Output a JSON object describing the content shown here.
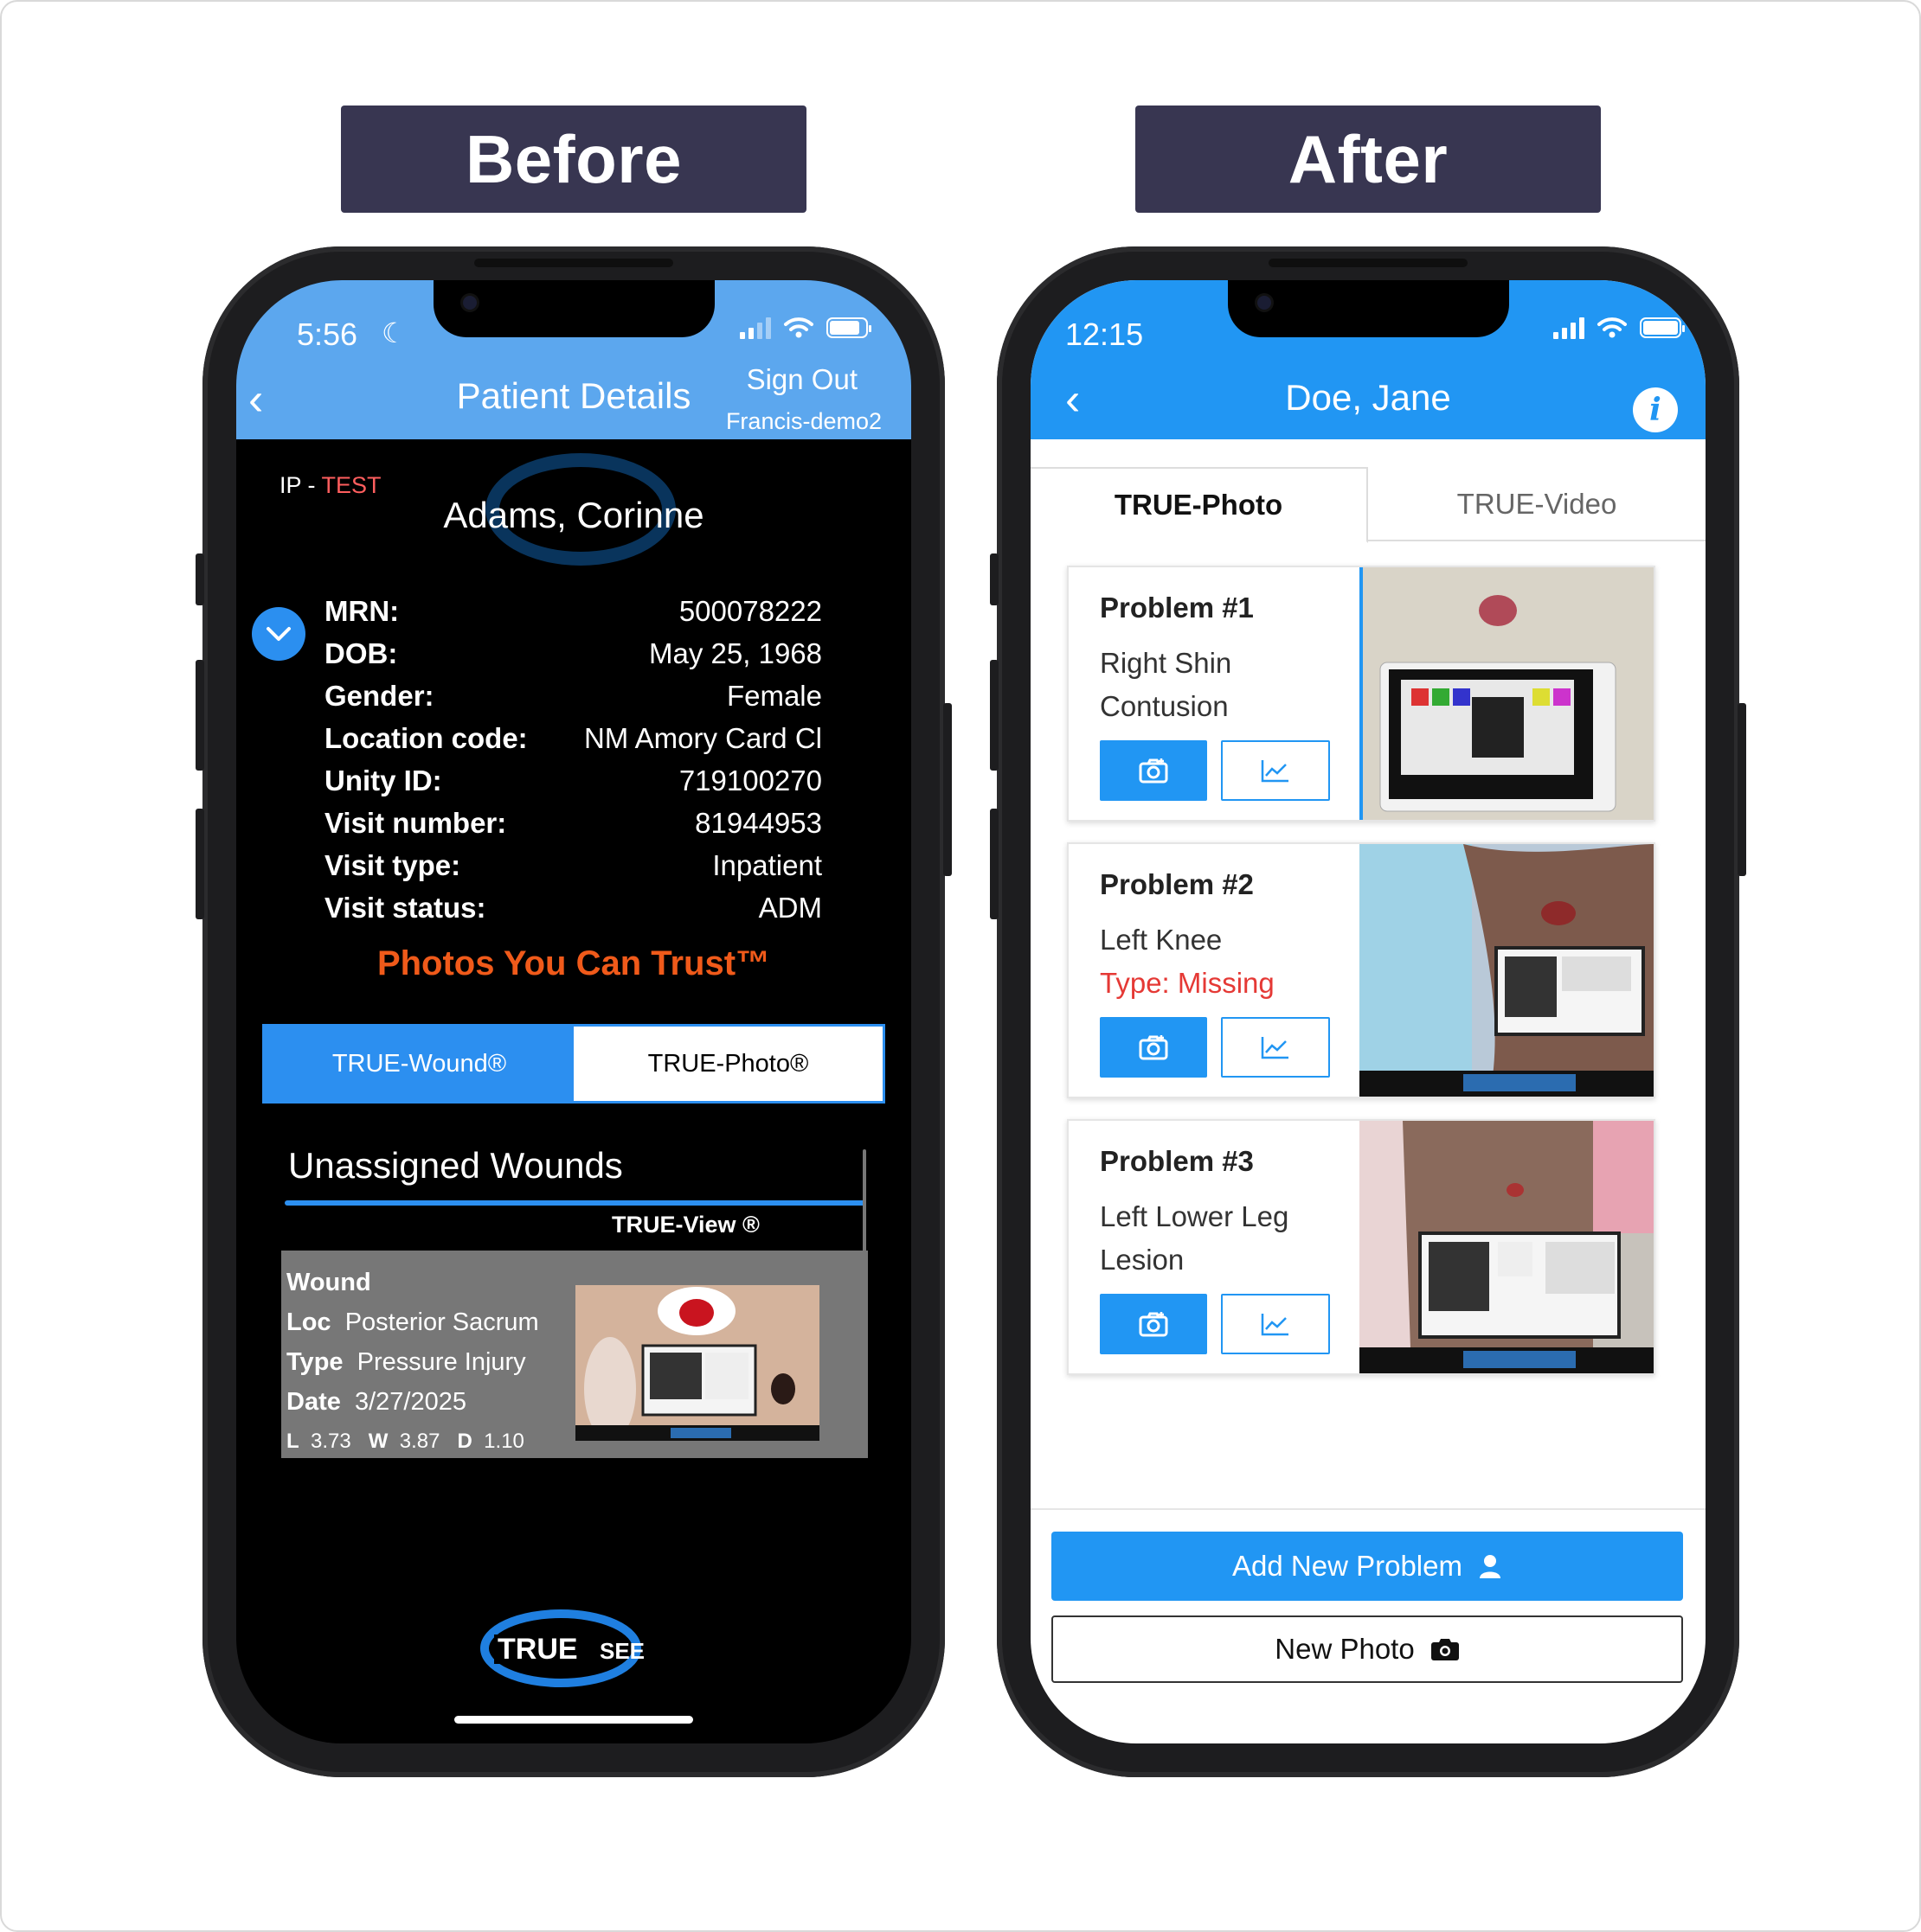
{
  "labels": {
    "before": "Before",
    "after": "After"
  },
  "before": {
    "status_time": "5:56",
    "header": {
      "title": "Patient Details",
      "sign_out": "Sign Out",
      "user": "Francis-demo2"
    },
    "ip_prefix": "IP - ",
    "ip_tag": "TEST",
    "patient_name": "Adams, Corinne",
    "details": [
      {
        "key": "MRN:",
        "value": "500078222"
      },
      {
        "key": "DOB:",
        "value": "May 25, 1968"
      },
      {
        "key": "Gender:",
        "value": "Female"
      },
      {
        "key": "Location code:",
        "value": "NM Amory Card Cl"
      },
      {
        "key": "Unity ID:",
        "value": "719100270"
      },
      {
        "key": "Visit number:",
        "value": "81944953"
      },
      {
        "key": "Visit type:",
        "value": "Inpatient"
      },
      {
        "key": "Visit status:",
        "value": "ADM"
      }
    ],
    "tagline": "Photos You Can Trust™",
    "tabs": [
      "TRUE-Wound®",
      "TRUE-Photo®"
    ],
    "section_title": "Unassigned Wounds",
    "trueview": "TRUE-View ®",
    "wound": {
      "heading": "Wound",
      "loc_label": "Loc",
      "loc": "Posterior Sacrum",
      "type_label": "Type",
      "type": "Pressure Injury",
      "date_label": "Date",
      "date": "3/27/2025",
      "l_label": "L",
      "l": "3.73",
      "w_label": "W",
      "w": "3.87",
      "d_label": "D",
      "d": "1.10"
    },
    "brand": {
      "part1": "TRUE",
      "part2": "SEE"
    }
  },
  "after": {
    "status_time": "12:15",
    "header": {
      "title": "Doe, Jane"
    },
    "tabs": [
      "TRUE-Photo",
      "TRUE-Video"
    ],
    "problems": [
      {
        "title": "Problem #1",
        "line1": "Right Shin",
        "line2": "Contusion",
        "missing": false
      },
      {
        "title": "Problem #2",
        "line1": "Left Knee",
        "line2": "Type: Missing",
        "missing": true
      },
      {
        "title": "Problem #3",
        "line1": "Left Lower Leg",
        "line2": "Lesion",
        "missing": false
      }
    ],
    "add_button": "Add New Problem",
    "new_photo_button": "New Photo"
  },
  "colors": {
    "label_bg": "#383651",
    "before_header": "#5ca7ee",
    "after_header": "#2196f3",
    "tagline": "#f05a1a",
    "missing": "#e53935"
  }
}
